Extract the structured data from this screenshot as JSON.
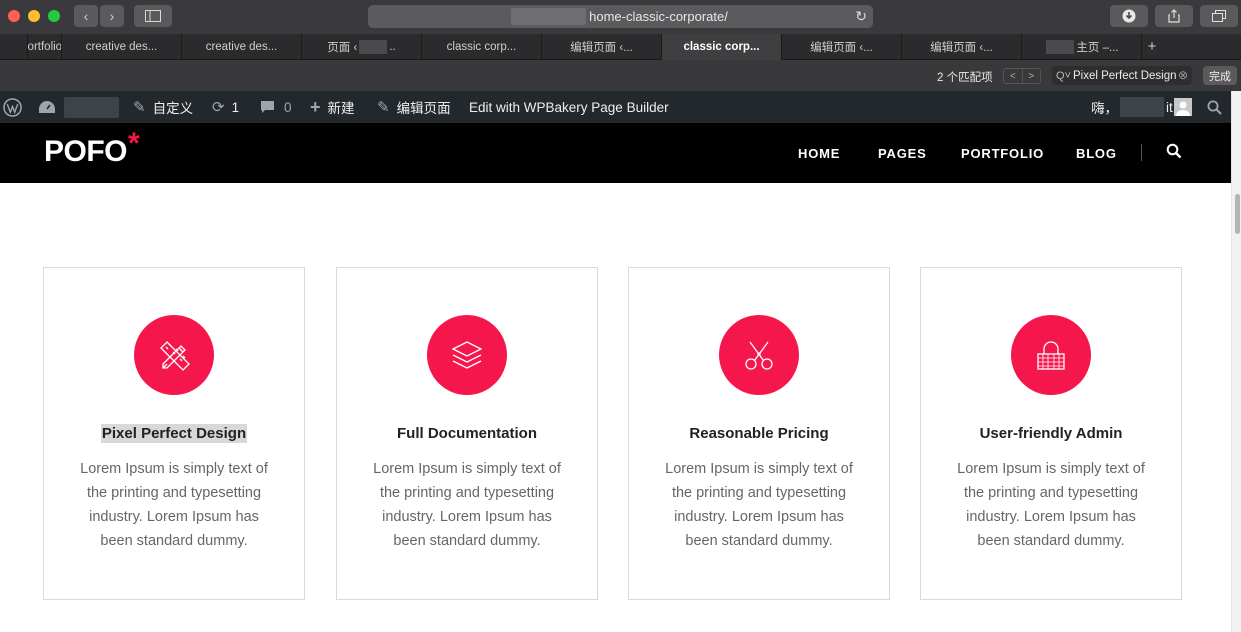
{
  "browser": {
    "url": "home-classic-corporate/",
    "tabs": [
      {
        "label": "",
        "width": 28
      },
      {
        "label": "Portfolio ‹",
        "width": 34
      },
      {
        "label": "creative des...",
        "width": 120
      },
      {
        "label": "creative des...",
        "width": 120
      },
      {
        "label": "页面 ‹",
        "width": 120,
        "blur": true,
        "after": ".."
      },
      {
        "label": "classic corp...",
        "width": 120
      },
      {
        "label": "编辑页面 ‹...",
        "width": 120
      },
      {
        "label": "classic corp...",
        "width": 120,
        "active": true
      },
      {
        "label": "编辑页面 ‹...",
        "width": 120
      },
      {
        "label": "编辑页面 ‹...",
        "width": 120
      },
      {
        "label": "主页 –...",
        "width": 120,
        "blurBefore": true
      }
    ]
  },
  "findbar": {
    "count": "2 个匹配项",
    "query": "Pixel Perfect Design",
    "done_label": "完成"
  },
  "adminbar": {
    "customize": "自定义",
    "updates": "1",
    "comments": "0",
    "new": "新建",
    "edit_page": "编辑页面",
    "wpbakery": "Edit with WPBakery Page Builder",
    "greeting": "嗨，",
    "user_suffix": "it"
  },
  "site": {
    "logo": "POFO",
    "logo_mark": "*",
    "nav": [
      "HOME",
      "PAGES",
      "PORTFOLIO",
      "BLOG"
    ],
    "accent": "#f5164c"
  },
  "features": [
    {
      "icon": "pencil-ruler-icon",
      "title": "Pixel Perfect Design",
      "highlight": true,
      "text": "Lorem Ipsum is simply text of the printing and typesetting industry. Lorem Ipsum has been standard dummy."
    },
    {
      "icon": "layers-icon",
      "title": "Full Documentation",
      "text": "Lorem Ipsum is simply text of the printing and typesetting industry. Lorem Ipsum has been standard dummy."
    },
    {
      "icon": "scissors-icon",
      "title": "Reasonable Pricing",
      "text": "Lorem Ipsum is simply text of the printing and typesetting industry. Lorem Ipsum has been standard dummy."
    },
    {
      "icon": "lock-icon",
      "title": "User-friendly Admin",
      "text": "Lorem Ipsum is simply text of the printing and typesetting industry. Lorem Ipsum has been standard dummy."
    }
  ]
}
